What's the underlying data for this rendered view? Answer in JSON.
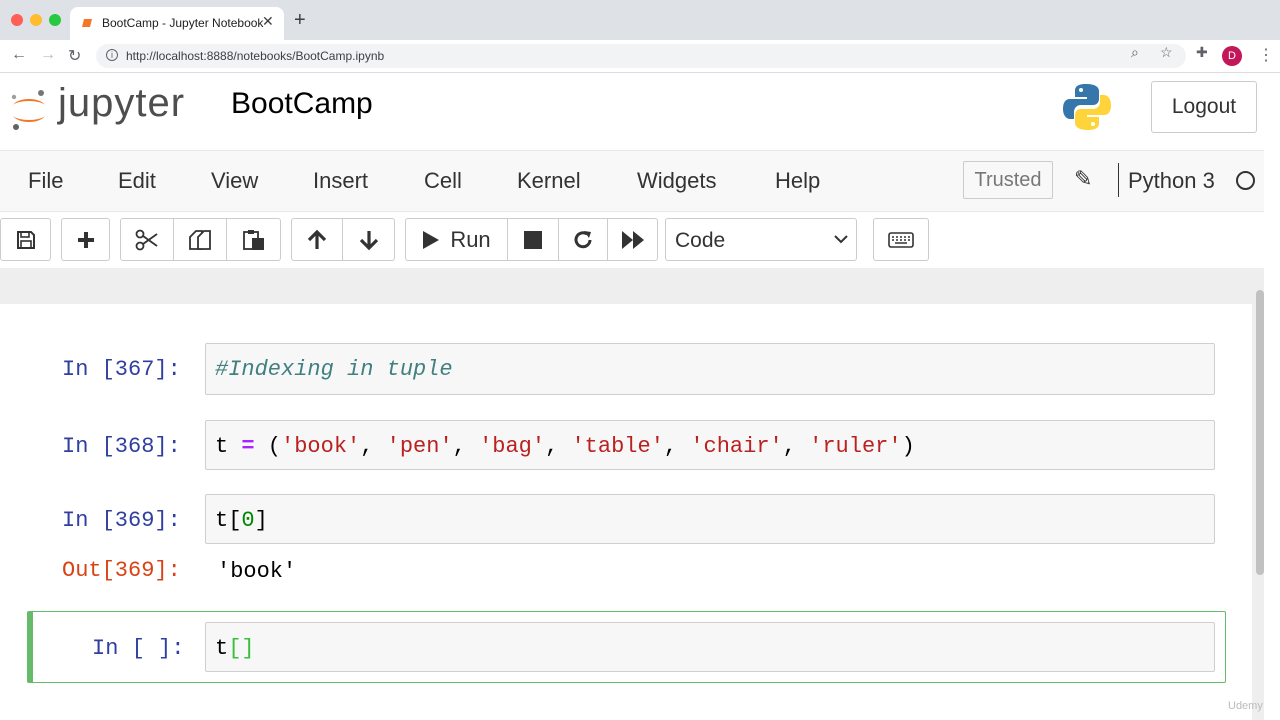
{
  "browser": {
    "tab_title": "BootCamp - Jupyter Notebook",
    "url": "http://localhost:8888/notebooks/BootCamp.ipynb",
    "profile_initial": "D"
  },
  "header": {
    "logo_text": "jupyter",
    "notebook_name": "BootCamp",
    "logout_label": "Logout"
  },
  "menu": {
    "items": [
      "File",
      "Edit",
      "View",
      "Insert",
      "Cell",
      "Kernel",
      "Widgets",
      "Help"
    ],
    "trusted_label": "Trusted",
    "kernel_name": "Python 3"
  },
  "toolbar": {
    "run_label": "Run",
    "cell_type": "Code"
  },
  "cells": [
    {
      "prompt": "In [367]:",
      "code": "#Indexing in tuple"
    },
    {
      "prompt": "In [368]:",
      "code": "t = ('book', 'pen', 'bag', 'table', 'chair', 'ruler')"
    },
    {
      "prompt": "In [369]:",
      "code": "t[0]",
      "out_prompt": "Out[369]:",
      "output": "'book'"
    },
    {
      "prompt": "In [ ]:",
      "code": "t[]"
    }
  ],
  "code_tokens": {
    "c2_t": "t ",
    "c2_eq": "=",
    "c2_open": " (",
    "c2_s1": "'book'",
    "c2_s2": "'pen'",
    "c2_s3": "'bag'",
    "c2_s4": "'table'",
    "c2_s5": "'chair'",
    "c2_s6": "'ruler'",
    "c2_sep": ", ",
    "c2_close": ")",
    "c3_t": "t",
    "c3_lb": "[",
    "c3_num": "0",
    "c3_rb": "]",
    "c4_t": "t",
    "c4_br": "[]"
  },
  "watermark": "Udemy",
  "colors": {
    "prompt_in": "#303f9f",
    "prompt_out": "#d84315",
    "selected_cell_border": "#66bb6a",
    "jupyter_orange": "#f37726"
  }
}
